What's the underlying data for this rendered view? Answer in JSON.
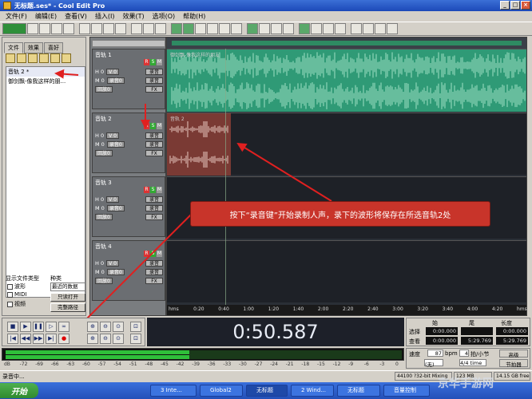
{
  "window": {
    "title": "无标题.ses* - Cool Edit Pro"
  },
  "menu": [
    "文件(F)",
    "编辑(E)",
    "查看(V)",
    "插入(I)",
    "效果(T)",
    "选项(O)",
    "帮助(H)"
  ],
  "left_panel": {
    "tabs": [
      "文件",
      "效果",
      "喜好"
    ],
    "items": [
      "音轨 2 *",
      "御剑飘-像我这样的朋..."
    ],
    "show_type_label": "显示文件类型",
    "sort_label": "种类",
    "types": [
      "波形",
      "MIDI",
      "视频"
    ],
    "sort_value": "最近的数据",
    "btn1": "只读打开",
    "btn2": "完整路径"
  },
  "tracks": [
    {
      "name": "音轨 1",
      "clip_label": "御剑飘-像我这样的朋友"
    },
    {
      "name": "音轨 2",
      "clip_label": "音轨 2"
    },
    {
      "name": "音轨 3",
      "clip_label": ""
    },
    {
      "name": "音轨 4",
      "clip_label": ""
    }
  ],
  "track_ctrl": {
    "rms": [
      "R",
      "S",
      "M"
    ],
    "vol_label": "V 0",
    "pan_label": "M 0",
    "h_label": "H 0",
    "record_label": "录音0",
    "play_label": "回放0",
    "fx_label": "FX",
    "out_label": "录音"
  },
  "annotation": "按下“录音键”开始录制人声，录下的波形将保存在所选音轨2处",
  "ruler": [
    "hms",
    "0:20",
    "0:40",
    "1:00",
    "1:20",
    "1:40",
    "2:00",
    "2:20",
    "2:40",
    "3:00",
    "3:20",
    "3:40",
    "4:00",
    "4:20",
    "hms"
  ],
  "time_display": "0:50.587",
  "selection": {
    "headers": [
      "始",
      "尾",
      "长度"
    ],
    "row1_label": "选择",
    "row2_label": "查看",
    "row1": [
      "0:00.000",
      "",
      "0:00.000"
    ],
    "row2": [
      "0:00.000",
      "5:29.769",
      "5:29.769"
    ]
  },
  "tempo": {
    "tempo_label": "速度",
    "tempo_value": "87",
    "bpm": "bpm",
    "beats": "4",
    "beats_unit": "拍/小节",
    "key_label": "(无)",
    "time_sig": "4/4 time",
    "btn_advanced": "高级",
    "btn_metronome": "节拍器"
  },
  "meter_scale": [
    "dB",
    "-72",
    "-69",
    "-66",
    "-63",
    "-60",
    "-57",
    "-54",
    "-51",
    "-48",
    "-45",
    "-42",
    "-39",
    "-36",
    "-33",
    "-30",
    "-27",
    "-24",
    "-21",
    "-18",
    "-15",
    "-12",
    "-9",
    "-6",
    "-3",
    "0"
  ],
  "status": {
    "message": "录音中...",
    "format": "44100 ?32-bit Mixing",
    "size": "123 MB",
    "free": "14.15 GB free"
  },
  "taskbar": {
    "start": "开始",
    "tasks": [
      "3 Inte...",
      "Global2",
      "无标题",
      "2 Wind...",
      "无标题",
      "音量控制"
    ]
  },
  "watermark": "京华手游网"
}
